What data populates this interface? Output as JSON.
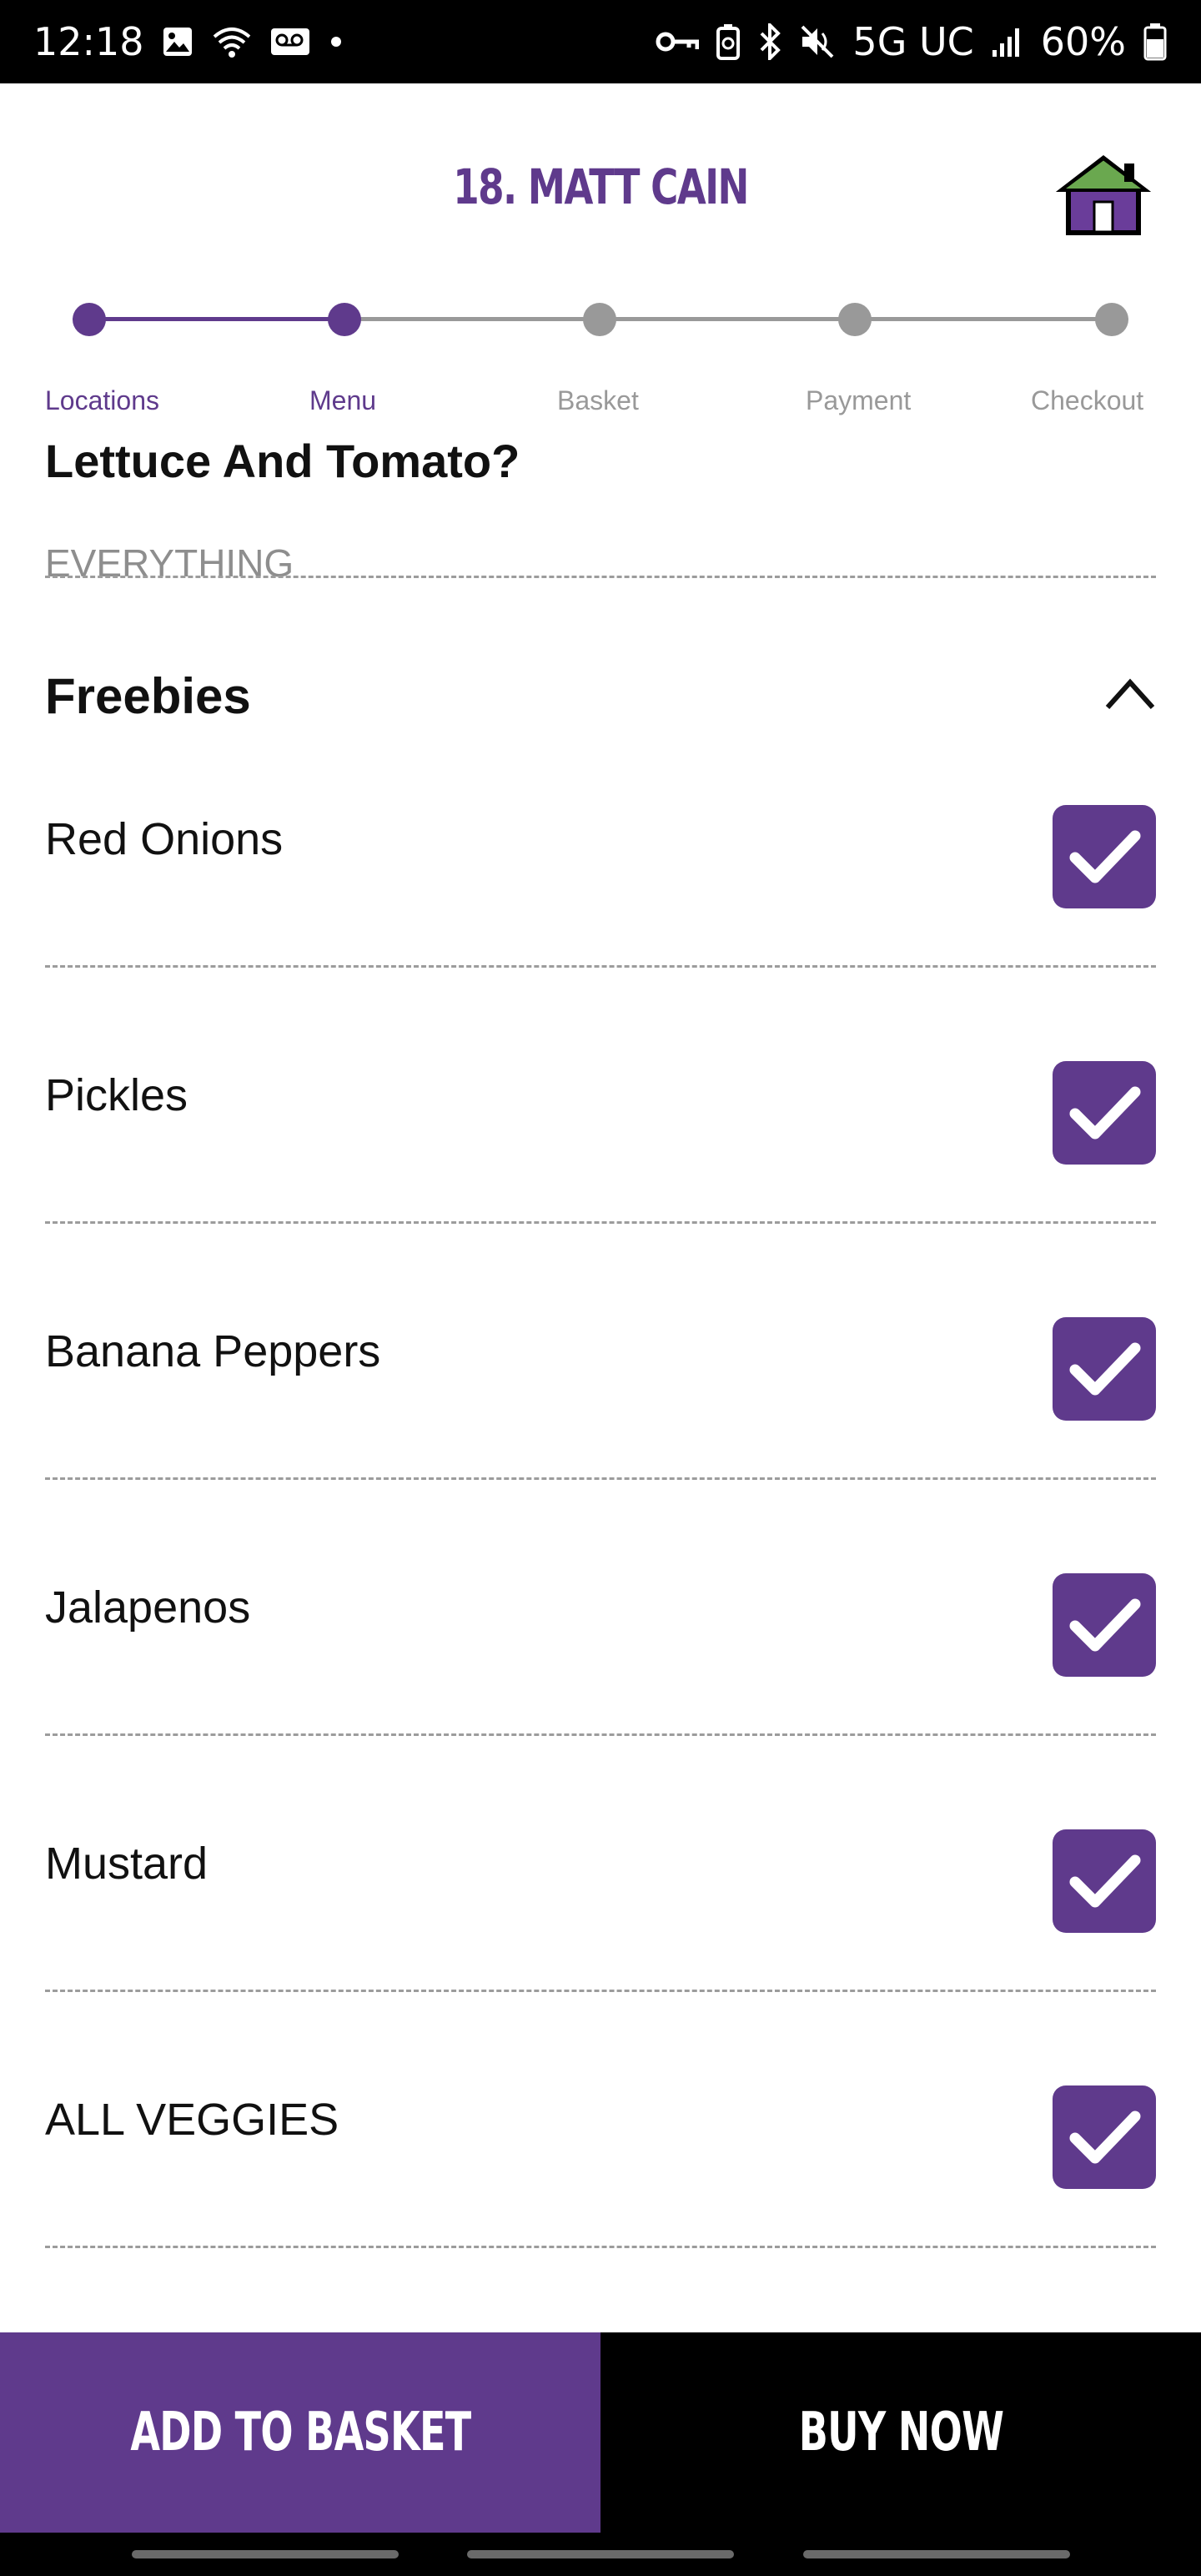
{
  "status_bar": {
    "time": "12:18",
    "network": "5G UC",
    "battery": "60%",
    "icons_left": [
      "image-icon",
      "wifi-icon",
      "voicemail-icon",
      "dot-icon"
    ],
    "icons_right": [
      "key-icon",
      "battery-saver-icon",
      "bluetooth-icon",
      "mute-icon",
      "signal-icon",
      "battery-icon"
    ]
  },
  "header": {
    "title": "18. MATT CAIN",
    "home_icon": "home-icon"
  },
  "stepper": {
    "active_color": "#5f3a8c",
    "inactive_color": "#999999",
    "current_step": 2,
    "steps": [
      {
        "label": "Locations",
        "done": true
      },
      {
        "label": "Menu",
        "done": true
      },
      {
        "label": "Basket",
        "done": false
      },
      {
        "label": "Payment",
        "done": false
      },
      {
        "label": "Checkout",
        "done": false
      }
    ]
  },
  "previous_item": {
    "title": "Lettuce And Tomato?",
    "value": "EVERYTHING"
  },
  "freebies": {
    "title": "Freebies",
    "expanded": true,
    "options": [
      {
        "label": "Red Onions",
        "checked": true
      },
      {
        "label": "Pickles",
        "checked": true
      },
      {
        "label": "Banana Peppers",
        "checked": true
      },
      {
        "label": "Jalapenos",
        "checked": true
      },
      {
        "label": "Mustard",
        "checked": true
      },
      {
        "label": "ALL VEGGIES",
        "checked": true
      }
    ]
  },
  "footer": {
    "add_to_basket": "ADD TO BASKET",
    "buy_now": "BUY NOW"
  },
  "colors": {
    "brand_purple": "#5f3a8c",
    "black": "#000000"
  }
}
